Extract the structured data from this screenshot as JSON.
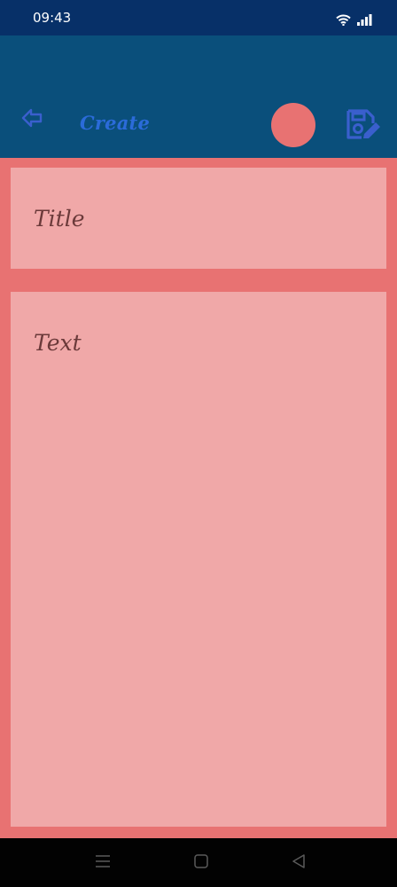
{
  "status_bar": {
    "time": "09:43",
    "icons": [
      "wifi-icon",
      "signal-icon"
    ]
  },
  "app_bar": {
    "back_icon": "arrow-left-icon",
    "title": "Create",
    "color_picker_color": "#E87272",
    "save_icon": "save-note-icon"
  },
  "editor": {
    "title_placeholder": "Title",
    "text_placeholder": "Text"
  },
  "nav_bar": {
    "icons": [
      "menu-icon",
      "home-icon",
      "back-icon"
    ]
  },
  "colors": {
    "status_bar": "#073068",
    "app_bar": "#0A4F7B",
    "accent_blue": "#2B6BD9",
    "note_background": "#E87272",
    "field_background": "#F0A8A8",
    "placeholder_text": "#6B3A3A"
  }
}
